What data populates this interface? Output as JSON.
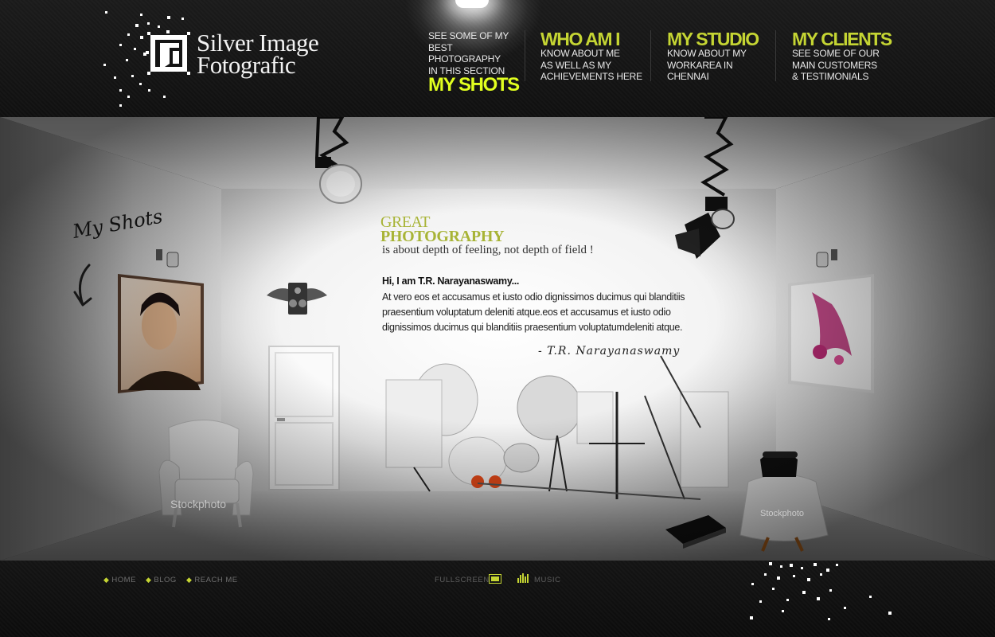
{
  "brand": {
    "name_line1": "Silver Image",
    "name_line2": "Fotografic"
  },
  "nav": [
    {
      "id": "my-shots",
      "title": "MY SHOTS",
      "desc": [
        "SEE SOME OF MY",
        "BEST PHOTOGRAPHY",
        "IN THIS SECTION"
      ],
      "active": true
    },
    {
      "id": "who-am-i",
      "title": "WHO AM I",
      "desc": [
        "KNOW ABOUT ME",
        "AS WELL AS MY",
        "ACHIEVEMENTS HERE"
      ],
      "active": false
    },
    {
      "id": "my-studio",
      "title": "MY STUDIO",
      "desc": [
        "KNOW ABOUT MY",
        "WORKAREA IN",
        "CHENNAI"
      ],
      "active": false
    },
    {
      "id": "my-clients",
      "title": "MY CLIENTS",
      "desc": [
        "SEE SOME OF OUR",
        "MAIN CUSTOMERS",
        "& TESTIMONIALS"
      ],
      "active": false
    }
  ],
  "main": {
    "headline_small": "GREAT",
    "headline_big": "PHOTOGRAPHY",
    "tagline": "is about depth of feeling, not depth of field !",
    "intro_heading": "Hi, I am T.R. Narayanaswamy...",
    "intro_body": "At vero eos et accusamus et iusto odio dignissimos ducimus qui blanditiis praesentium voluptatum deleniti atque.eos et accusamus et iusto odio dignissimos ducimus qui blanditiis praesentium voluptatumdeleniti atque.",
    "signature": "- T.R. Narayanaswamy",
    "myshots_label": "My Shots",
    "watermark": "Stockphoto"
  },
  "footer": {
    "links": [
      "HOME",
      "BLOG",
      "REACH ME"
    ],
    "fullscreen_label": "FULLSCREEN",
    "music_label": "MUSIC"
  },
  "colors": {
    "accent": "#c5d533",
    "accent_bright": "#e1ff1f",
    "headline": "#a8b437",
    "background": "#151515"
  },
  "icons": [
    "camera-logo-icon",
    "winged-camera-icon",
    "arrow-icon",
    "fullscreen-icon",
    "music-bars-icon",
    "bullet-icon"
  ]
}
